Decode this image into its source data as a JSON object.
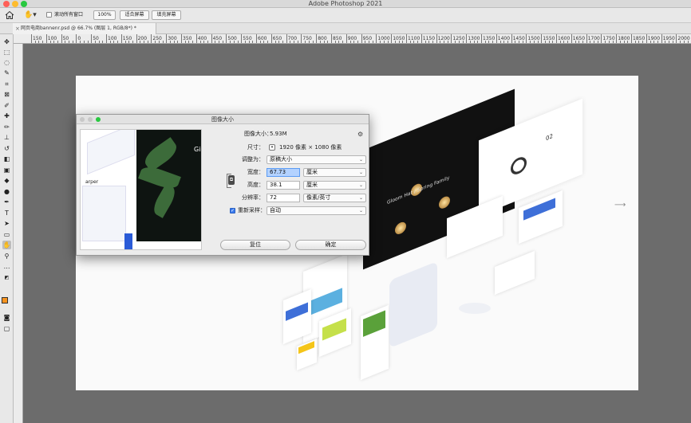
{
  "app": {
    "title": "Adobe Photoshop 2021"
  },
  "options_bar": {
    "scroll_all_label": "滚动所有窗口",
    "zoom_100_label": "100%",
    "fit_screen_label": "适合屏幕",
    "fill_screen_label": "填充屏幕"
  },
  "document_tab": {
    "title": "网页电商bannenr.psd @ 66.7% (图层 1, RGB/8*) *"
  },
  "ruler": {
    "labels": [
      "150",
      "100",
      "50",
      "0",
      "50",
      "100",
      "150",
      "200",
      "250",
      "300",
      "350",
      "400",
      "450",
      "500",
      "550",
      "600",
      "650",
      "700",
      "750",
      "800",
      "850",
      "900",
      "950",
      "1000",
      "1050",
      "1100",
      "1150",
      "1200",
      "1250",
      "1300",
      "1350",
      "1400",
      "1450",
      "1500",
      "1550",
      "1600",
      "1650",
      "1700",
      "1750",
      "1800",
      "1850",
      "1900",
      "1950",
      "2000",
      "2050"
    ]
  },
  "dialog": {
    "title": "图像大小",
    "image_size_label": "图像大小：",
    "image_size_value": "5.93M",
    "dimensions_label": "尺寸：",
    "dimensions_value": "1920 像素  ×  1080 像素",
    "fit_to_label": "调整为：",
    "fit_to_value": "原稿大小",
    "width_label": "宽度：",
    "width_value": "67.73",
    "width_unit": "厘米",
    "height_label": "高度：",
    "height_value": "38.1",
    "height_unit": "厘米",
    "resolution_label": "分辨率：",
    "resolution_value": "72",
    "resolution_unit": "像素/英寸",
    "resample_label": "重新采样：",
    "resample_value": "自动",
    "cancel_label": "复位",
    "ok_label": "确定",
    "preview_text_1": "arper",
    "preview_text_2": "Gi"
  },
  "canvas": {
    "screen_text": "Gloom Hat / Spring Family",
    "card_number": "02"
  },
  "colors": {
    "foreground": "#f7931e",
    "background": "#ffffff"
  }
}
